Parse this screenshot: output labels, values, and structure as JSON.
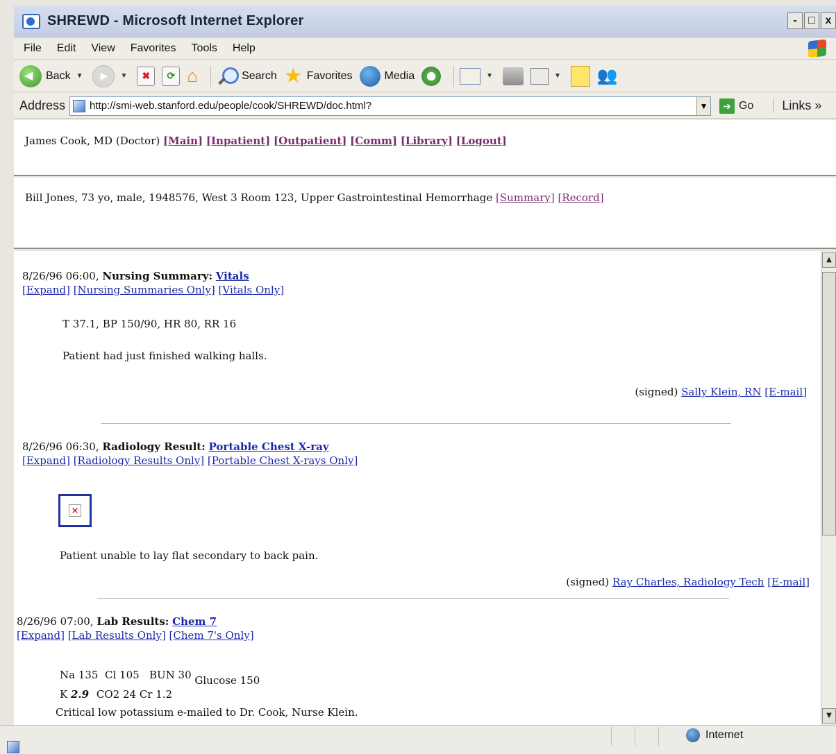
{
  "window": {
    "title": "SHREWD - Microsoft Internet Explorer",
    "buttons": [
      "-",
      "□",
      "x"
    ]
  },
  "menu": [
    "File",
    "Edit",
    "View",
    "Favorites",
    "Tools",
    "Help"
  ],
  "toolbar": {
    "back": "Back",
    "search": "Search",
    "favorites": "Favorites",
    "media": "Media"
  },
  "address": {
    "label": "Address",
    "url": "http://smi-web.stanford.edu/people/cook/SHREWD/doc.html?",
    "go": "Go",
    "links": "Links"
  },
  "user": {
    "name": "James Cook, MD (Doctor)",
    "nav": [
      "[Main]",
      "[Inpatient]",
      "[Outpatient]",
      "[Comm]",
      "[Library]",
      "[Logout]"
    ]
  },
  "patient": {
    "info": "Bill Jones, 73 yo, male, 1948576, West 3 Room 123, Upper Gastrointestinal Hemorrhage",
    "links": [
      "[Summary]",
      "[Record]"
    ]
  },
  "entries": [
    {
      "datetime": "8/26/96 06:00,",
      "type": "Nursing Summary:",
      "item": "Vitals",
      "links": [
        "[Expand]",
        "[Nursing Summaries Only]",
        "[Vitals Only]"
      ],
      "line1": "T 37.1, BP 150/90, HR 80, RR 16",
      "line2": "Patient had just finished walking halls.",
      "signed_label": "(signed)",
      "signer": "Sally Klein, RN",
      "email": "[E-mail]"
    },
    {
      "datetime": "8/26/96 06:30,",
      "type": "Radiology Result:",
      "item": "Portable Chest X-ray",
      "links": [
        "[Expand]",
        "[Radiology Results Only]",
        "[Portable Chest X-rays Only]"
      ],
      "line1": "Patient unable to lay flat secondary to back pain.",
      "signed_label": "(signed)",
      "signer": "Ray Charles, Radiology Tech",
      "email": "[E-mail]"
    },
    {
      "datetime": "8/26/96 07:00,",
      "type": "Lab Results:",
      "item": "Chem 7",
      "links": [
        "[Expand]",
        "[Lab Results Only]",
        "[Chem 7's Only]"
      ],
      "labs_row1": "Na 135  Cl 105   BUN 30",
      "glucose": "Glucose 150",
      "k_label": "K",
      "k_value": "2.9",
      "labs_row2_rest": "CO2 24  Cr 1.2",
      "note": "Critical low potassium e-mailed to Dr. Cook, Nurse Klein."
    }
  ],
  "status": {
    "zone": "Internet"
  }
}
